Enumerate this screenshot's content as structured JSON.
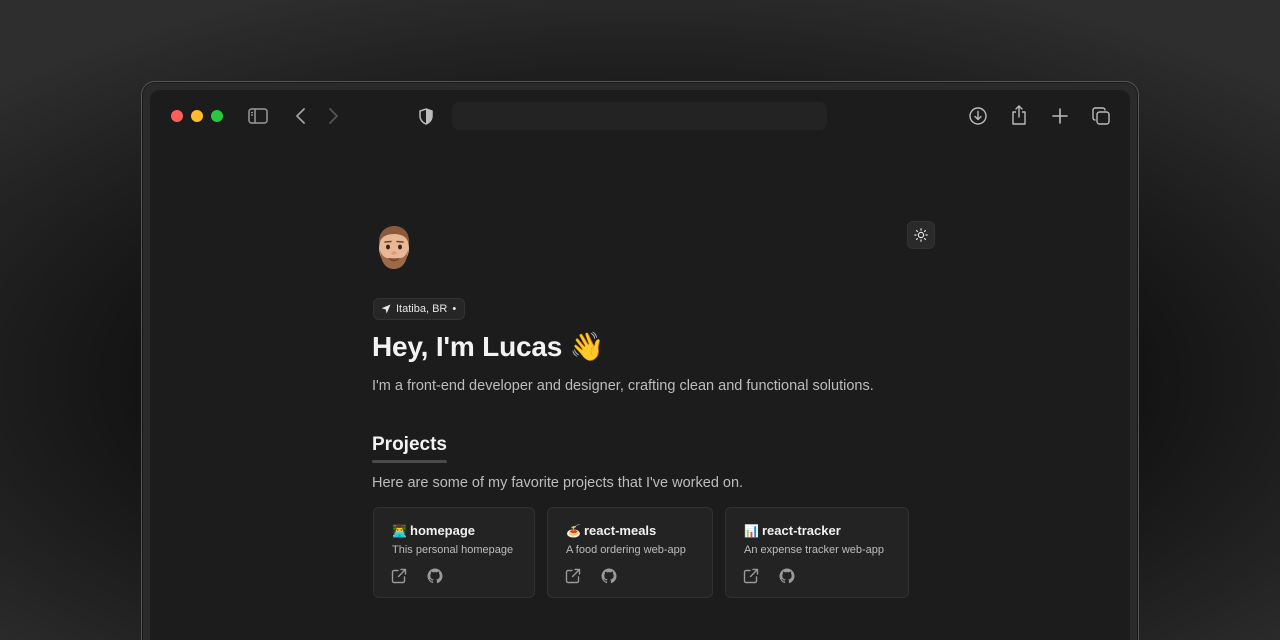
{
  "window": {
    "traffic_lights": [
      "#ff5f57",
      "#febc2e",
      "#28c840"
    ]
  },
  "toolbar": {
    "icons": [
      "sidebar-icon",
      "back-icon",
      "forward-icon",
      "shield-icon",
      "download-icon",
      "share-icon",
      "new-tab-icon",
      "tabs-icon"
    ],
    "url": ""
  },
  "profile": {
    "location": "Itatiba, BR",
    "location_dot": "•",
    "title": "Hey, I'm Lucas",
    "title_emoji": "👋",
    "subtitle": "I'm a front-end developer and designer, crafting clean and functional solutions."
  },
  "projects": {
    "heading": "Projects",
    "description": "Here are some of my favorite projects that I've worked on.",
    "items": [
      {
        "emoji": "👨‍💻",
        "name": "homepage",
        "description": "This personal homepage"
      },
      {
        "emoji": "🍝",
        "name": "react-meals",
        "description": "A food ordering web-app"
      },
      {
        "emoji": "📊",
        "name": "react-tracker",
        "description": "An expense tracker web-app"
      }
    ]
  },
  "colors": {
    "background": "#1c1c1c",
    "card": "#232323",
    "text_primary": "#f3f3f3",
    "text_secondary": "#bdbdbd"
  }
}
